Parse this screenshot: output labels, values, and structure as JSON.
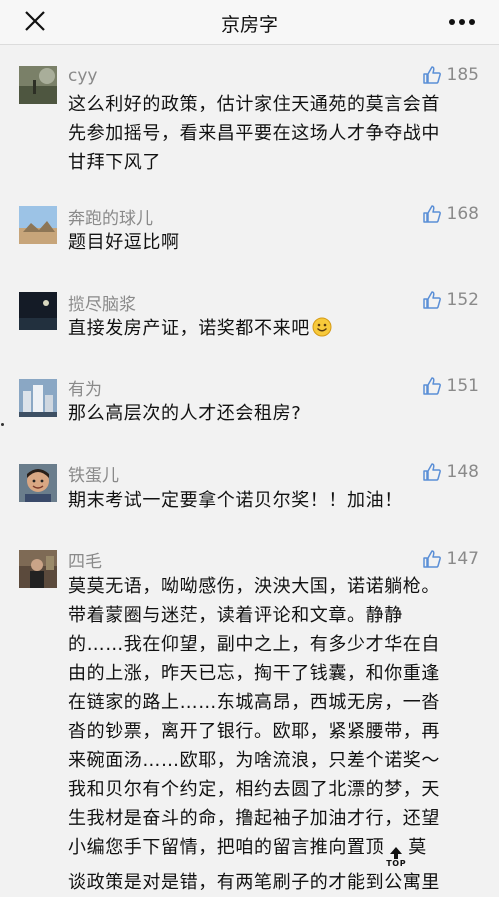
{
  "header": {
    "title": "京房字"
  },
  "comments": [
    {
      "name": "cyy",
      "likes": "185",
      "lines": [
        "这么利好的政策，估计家住天通苑的莫言会首",
        "先参加摇号，看来昌平要在这场人才争夺战中",
        "甘拜下风了"
      ]
    },
    {
      "name": "奔跑的球儿",
      "likes": "168",
      "lines": [
        "题目好逗比啊"
      ]
    },
    {
      "name": "揽尽脑浆",
      "likes": "152",
      "lines": [
        "直接发房产证，诺奖都不来吧"
      ]
    },
    {
      "name": "有为",
      "likes": "151",
      "lines": [
        "那么高层次的人才还会租房?"
      ]
    },
    {
      "name": "铁蛋儿",
      "likes": "148",
      "lines": [
        "期末考试一定要拿个诺贝尔奖！！加油！"
      ]
    },
    {
      "name": "四毛",
      "likes": "147",
      "lines": [
        "莫莫无语，呦呦感伤，泱泱大国，诺诺躺枪。",
        "带着蒙圈与迷茫，读着评论和文章。静静",
        "的……我在仰望，副中之上，有多少才华在自",
        "由的上涨，昨天已忘，掏干了钱囊，和你重逢",
        "在链家的路上……东城高昂，西城无房，一沓",
        "沓的钞票，离开了银行。欧耶，紧紧腰带，再",
        "来碗面汤……欧耶，为啥流浪，只差个诺奖～",
        "我和贝尔有个约定，相约去圆了北漂的梦，天",
        "生我材是奋斗的命，撸起袖子加油才行，还望",
        "小编您手下留情，把咱的留言推向置顶",
        "谈政策是对是错，有两笔刷子的才能到公寓里"
      ],
      "line10_tail": "莫",
      "top_button_label": "TOP"
    }
  ]
}
